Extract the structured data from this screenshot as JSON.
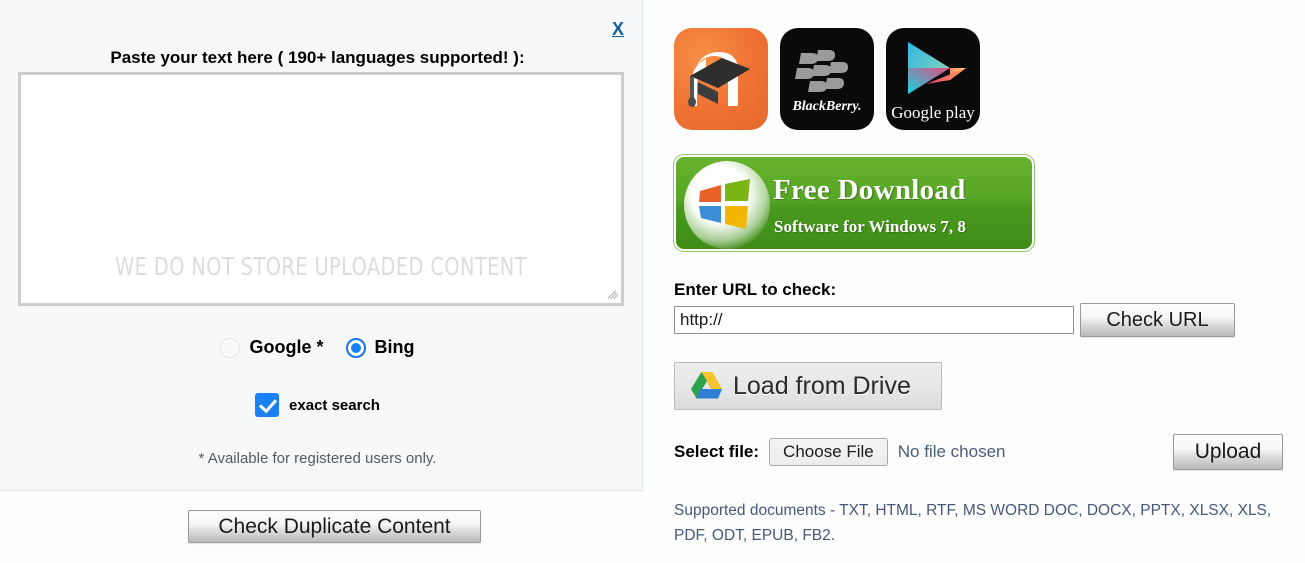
{
  "left": {
    "close_label": "X",
    "paste_heading": "Paste your text here ( 190+ languages supported! ):",
    "textarea_value": "",
    "textarea_watermark": "WE DO NOT STORE UPLOADED CONTENT",
    "engines": [
      {
        "label": "Google *",
        "selected": false,
        "icon": "radio-off-icon"
      },
      {
        "label": "Bing",
        "selected": true,
        "icon": "radio-on-icon"
      }
    ],
    "exact_search_label": "exact search",
    "exact_search_checked": true,
    "note": "* Available for registered users only.",
    "check_duplicate_label": "Check Duplicate Content"
  },
  "right": {
    "app_icons": [
      {
        "name": "moodle-icon",
        "label": "Moodle"
      },
      {
        "name": "blackberry-icon",
        "label": "BlackBerry"
      },
      {
        "name": "google-play-icon",
        "label": "Google play"
      }
    ],
    "free_download": {
      "title": "Free Download",
      "subtitle": "Software for Windows 7, 8",
      "icon": "windows-logo-icon",
      "color": "#4f9e21"
    },
    "url_label": "Enter URL to check:",
    "url_value": "http://",
    "url_placeholder": "http://",
    "check_url_label": "Check URL",
    "drive_button_label": "Load from Drive",
    "drive_icon": "google-drive-icon",
    "select_file_label": "Select file:",
    "choose_file_label": "Choose File",
    "no_file_label": "No file chosen",
    "upload_label": "Upload",
    "supported_documents": "Supported documents - TXT, HTML, RTF, MS WORD DOC, DOCX, PPTX, XLSX, XLS, PDF, ODT, EPUB, FB2."
  },
  "colors": {
    "accent_blue": "#1a81f7",
    "link_blue": "#15619c",
    "muted_blue": "#46597a",
    "green": "#4f9e21",
    "moodle_orange": "#ef7133"
  }
}
